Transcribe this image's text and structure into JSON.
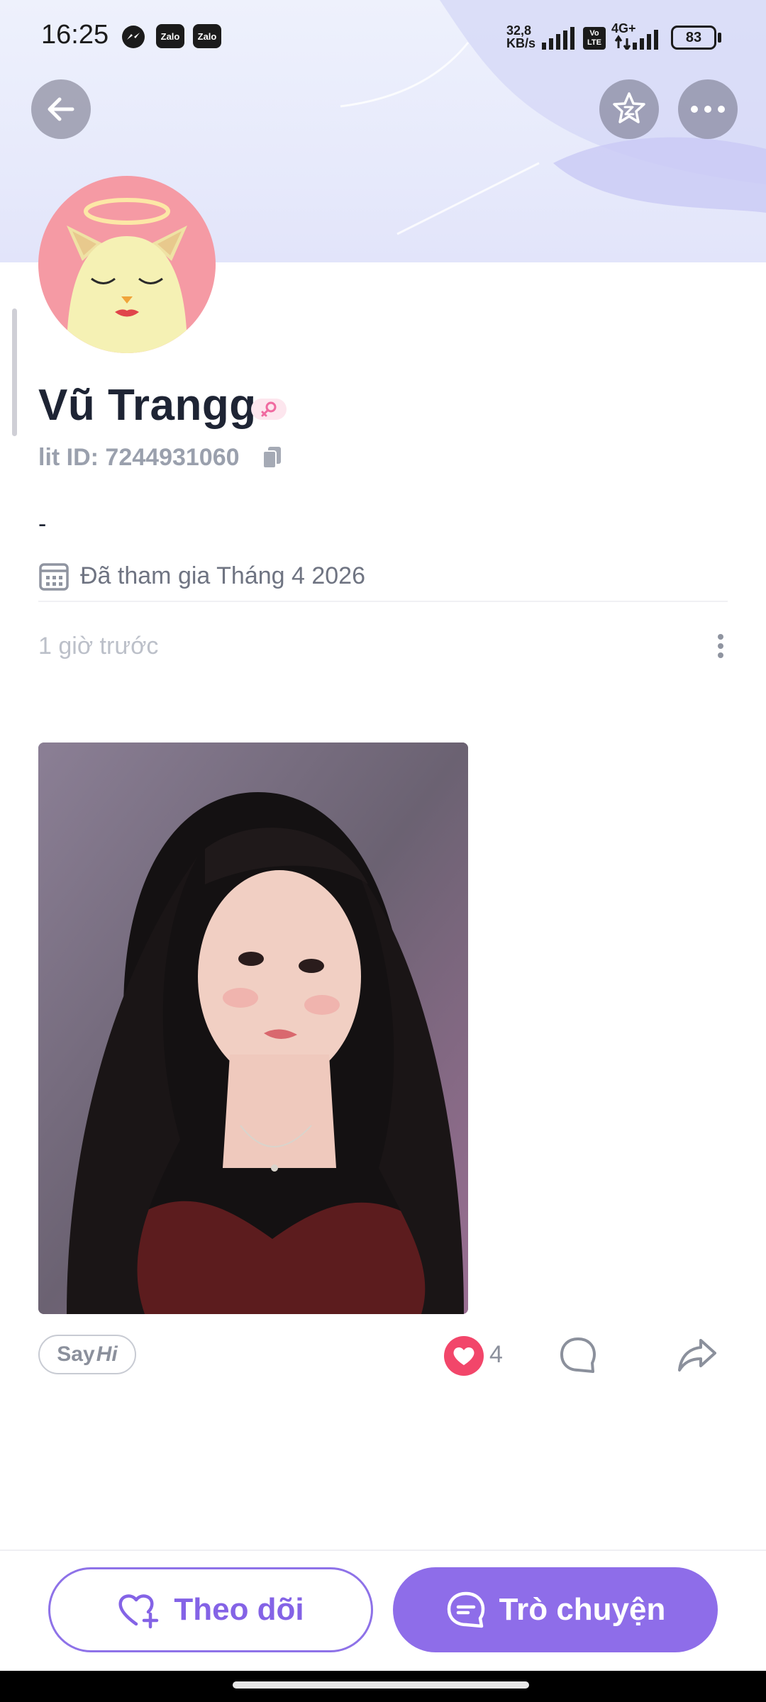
{
  "status_bar": {
    "time": "16:25",
    "net_speed_top": "32,8",
    "net_speed_bottom": "KB/s",
    "volte_top": "Vo",
    "volte_bottom": "LTE",
    "network": "4G+",
    "battery": "83",
    "app_icons": [
      "messenger-icon",
      "zalo-icon",
      "zalo-icon"
    ],
    "zalo_label": "Zalo"
  },
  "header": {
    "back_icon": "arrow-left-icon",
    "favorite_icon": "star-z-icon",
    "more_icon": "more-horizontal-icon"
  },
  "profile": {
    "name": "Vũ Trangg",
    "gender_icon": "female-icon",
    "lit_id": "lit ID: 7244931060",
    "bio": "-",
    "joined": "Đã tham gia Tháng 4 2026"
  },
  "post": {
    "time": "1 giờ trước",
    "say_label": "Say",
    "hi_label": "Hi",
    "like_count": "4"
  },
  "actions": {
    "follow_label": "Theo dõi",
    "chat_label": "Trò chuyện"
  },
  "colors": {
    "accent": "#8e6de9",
    "like": "#f2466a",
    "avatar_bg": "#f59aa4"
  }
}
